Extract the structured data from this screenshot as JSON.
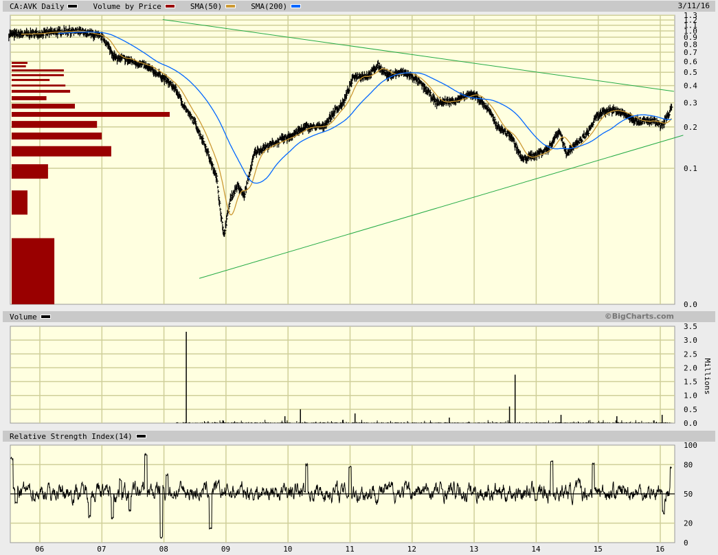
{
  "header": {
    "symbol_label": "CA:AVK Daily",
    "vbp_label": "Volume by Price",
    "sma50_label": "SMA(50)",
    "sma200_label": "SMA(200)",
    "date": "3/11/16"
  },
  "volume_header": {
    "label": "Volume",
    "credit": "©BigCharts.com"
  },
  "rsi_header": {
    "label": "Relative Strength Index(14)"
  },
  "colors": {
    "price": "#000000",
    "vbp": "#990000",
    "sma50": "#cc9933",
    "sma200": "#0066ff",
    "trendline": "#22aa44",
    "plot_bg": "#ffffe0",
    "grid": "#cfcf99"
  },
  "chart_data": [
    {
      "type": "ohlc",
      "title": "CA:AVK Daily",
      "scale": "log",
      "x_ticks": [
        {
          "t": 2006,
          "label": "06"
        },
        {
          "t": 2007,
          "label": "07"
        },
        {
          "t": 2008,
          "label": "08"
        },
        {
          "t": 2009,
          "label": "09"
        },
        {
          "t": 2010,
          "label": "10"
        },
        {
          "t": 2011,
          "label": "11"
        },
        {
          "t": 2012,
          "label": "12"
        },
        {
          "t": 2013,
          "label": "13"
        },
        {
          "t": 2014,
          "label": "14"
        },
        {
          "t": 2015,
          "label": "15"
        },
        {
          "t": 2016,
          "label": "16"
        }
      ],
      "y_ticks": [
        {
          "v": 1.3,
          "label": "1.3"
        },
        {
          "v": 1.2,
          "label": "1.2"
        },
        {
          "v": 1.1,
          "label": "1.1"
        },
        {
          "v": 1.0,
          "label": "1.0"
        },
        {
          "v": 0.9,
          "label": "0.9"
        },
        {
          "v": 0.8,
          "label": "0.8"
        },
        {
          "v": 0.7,
          "label": "0.7"
        },
        {
          "v": 0.6,
          "label": "0.6"
        },
        {
          "v": 0.5,
          "label": "0.5"
        },
        {
          "v": 0.4,
          "label": "0.4"
        },
        {
          "v": 0.3,
          "label": "0.3"
        },
        {
          "v": 0.2,
          "label": "0.2"
        },
        {
          "v": 0.1,
          "label": "0.1"
        },
        {
          "v": 0.0102,
          "label": "0.0"
        }
      ],
      "x_range": [
        2005.5,
        2016.19
      ],
      "price_path": [
        [
          2005.52,
          0.94
        ],
        [
          2006.02,
          0.96
        ],
        [
          2006.47,
          1.0
        ],
        [
          2006.8,
          0.96
        ],
        [
          2007.02,
          0.89
        ],
        [
          2007.22,
          0.63
        ],
        [
          2007.35,
          0.63
        ],
        [
          2007.68,
          0.56
        ],
        [
          2007.96,
          0.47
        ],
        [
          2008.18,
          0.38
        ],
        [
          2008.35,
          0.27
        ],
        [
          2008.51,
          0.21
        ],
        [
          2008.68,
          0.14
        ],
        [
          2008.85,
          0.084
        ],
        [
          2008.96,
          0.032
        ],
        [
          2009.07,
          0.06
        ],
        [
          2009.18,
          0.075
        ],
        [
          2009.29,
          0.063
        ],
        [
          2009.46,
          0.13
        ],
        [
          2009.73,
          0.15
        ],
        [
          2010.01,
          0.17
        ],
        [
          2010.29,
          0.2
        ],
        [
          2010.56,
          0.2
        ],
        [
          2010.78,
          0.27
        ],
        [
          2010.89,
          0.3
        ],
        [
          2011.06,
          0.47
        ],
        [
          2011.28,
          0.47
        ],
        [
          2011.45,
          0.56
        ],
        [
          2011.61,
          0.47
        ],
        [
          2011.83,
          0.5
        ],
        [
          2012.0,
          0.47
        ],
        [
          2012.17,
          0.4
        ],
        [
          2012.39,
          0.3
        ],
        [
          2012.66,
          0.31
        ],
        [
          2013.0,
          0.35
        ],
        [
          2013.22,
          0.27
        ],
        [
          2013.38,
          0.2
        ],
        [
          2013.6,
          0.17
        ],
        [
          2013.77,
          0.116
        ],
        [
          2013.99,
          0.126
        ],
        [
          2014.2,
          0.14
        ],
        [
          2014.37,
          0.19
        ],
        [
          2014.48,
          0.13
        ],
        [
          2014.65,
          0.15
        ],
        [
          2014.82,
          0.18
        ],
        [
          2014.98,
          0.24
        ],
        [
          2015.2,
          0.27
        ],
        [
          2015.42,
          0.25
        ],
        [
          2015.64,
          0.22
        ],
        [
          2015.91,
          0.22
        ],
        [
          2016.02,
          0.2
        ],
        [
          2016.19,
          0.28
        ]
      ],
      "sma_periods": [
        50,
        200
      ],
      "volume_by_price": [
        {
          "lo": 0.575,
          "hi": 0.595,
          "v": 0.1
        },
        {
          "lo": 0.543,
          "hi": 0.562,
          "v": 0.09
        },
        {
          "lo": 0.507,
          "hi": 0.525,
          "v": 0.33
        },
        {
          "lo": 0.468,
          "hi": 0.484,
          "v": 0.33
        },
        {
          "lo": 0.432,
          "hi": 0.447,
          "v": 0.24
        },
        {
          "lo": 0.394,
          "hi": 0.407,
          "v": 0.34
        },
        {
          "lo": 0.355,
          "hi": 0.372,
          "v": 0.37
        },
        {
          "lo": 0.313,
          "hi": 0.335,
          "v": 0.22
        },
        {
          "lo": 0.272,
          "hi": 0.295,
          "v": 0.4
        },
        {
          "lo": 0.237,
          "hi": 0.257,
          "v": 1.0
        },
        {
          "lo": 0.197,
          "hi": 0.221,
          "v": 0.54
        },
        {
          "lo": 0.162,
          "hi": 0.182,
          "v": 0.57
        },
        {
          "lo": 0.122,
          "hi": 0.145,
          "v": 0.63
        },
        {
          "lo": 0.084,
          "hi": 0.107,
          "v": 0.23
        },
        {
          "lo": 0.046,
          "hi": 0.069,
          "v": 0.1
        },
        {
          "lo": 0.0102,
          "hi": 0.031,
          "v": 0.27
        }
      ],
      "trendlines": [
        {
          "name": "upper-trendline",
          "from": [
            2007.98,
            1.21
          ],
          "to": [
            2016.22,
            0.363
          ]
        },
        {
          "name": "lower-trendline",
          "from": [
            2008.57,
            0.0158
          ],
          "to": [
            2016.37,
            0.174
          ]
        }
      ]
    },
    {
      "type": "bar",
      "title": "Volume",
      "ylabel": "Millions",
      "ylim": [
        0,
        3.5
      ],
      "y_ticks": [
        {
          "v": 3.5,
          "label": "3.5"
        },
        {
          "v": 3.0,
          "label": "3.0"
        },
        {
          "v": 2.5,
          "label": "2.5"
        },
        {
          "v": 2.0,
          "label": "2.0"
        },
        {
          "v": 1.5,
          "label": "1.5"
        },
        {
          "v": 1.0,
          "label": "1.0"
        },
        {
          "v": 0.5,
          "label": "0.5"
        },
        {
          "v": 0.0,
          "label": "0.0"
        }
      ],
      "spikes": [
        [
          2008.36,
          3.3
        ],
        [
          2013.66,
          1.75
        ],
        [
          2013.57,
          0.6
        ],
        [
          2010.2,
          0.5
        ],
        [
          2011.08,
          0.35
        ],
        [
          2008.95,
          0.1
        ],
        [
          2009.95,
          0.25
        ],
        [
          2014.4,
          0.3
        ],
        [
          2015.3,
          0.25
        ],
        [
          2016.03,
          0.3
        ],
        [
          2012.6,
          0.2
        ]
      ]
    },
    {
      "type": "line",
      "title": "Relative Strength Index(14)",
      "ylim": [
        0,
        100
      ],
      "y_ticks": [
        {
          "v": 100,
          "label": "100"
        },
        {
          "v": 80,
          "label": "80"
        },
        {
          "v": 50,
          "label": "50"
        },
        {
          "v": 20,
          "label": "20"
        },
        {
          "v": 0,
          "label": "0"
        }
      ],
      "key_points": [
        [
          2005.55,
          86
        ],
        [
          2005.62,
          40
        ],
        [
          2006.8,
          28
        ],
        [
          2007.17,
          25
        ],
        [
          2007.3,
          65
        ],
        [
          2007.45,
          32
        ],
        [
          2007.71,
          90
        ],
        [
          2007.96,
          5
        ],
        [
          2008.05,
          70
        ],
        [
          2008.75,
          15
        ],
        [
          2010.3,
          80
        ],
        [
          2011.0,
          78
        ],
        [
          2014.25,
          83
        ],
        [
          2014.92,
          82
        ],
        [
          2016.05,
          30
        ],
        [
          2016.18,
          75
        ]
      ]
    }
  ]
}
